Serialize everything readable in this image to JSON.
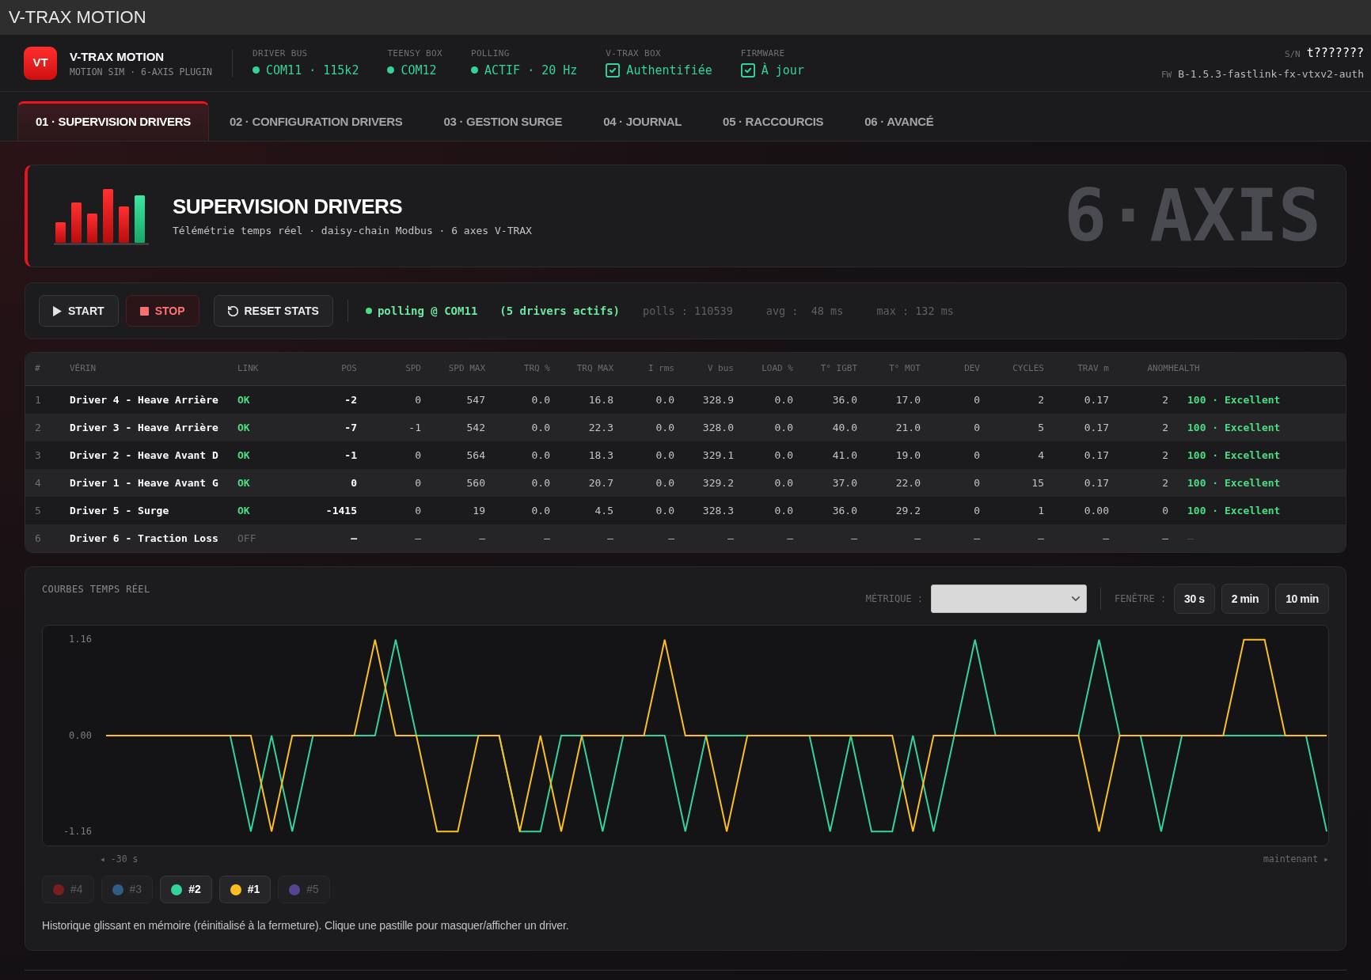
{
  "window": {
    "title": "V-TRAX MOTION"
  },
  "header": {
    "logo": "VT",
    "brand": "V-TRAX MOTION",
    "tagline": "MOTION SIM · 6-AXIS PLUGIN",
    "status": [
      {
        "kind": "dot",
        "label": "DRIVER BUS",
        "value": "COM11 · 115k2"
      },
      {
        "kind": "dot",
        "label": "TEENSY BOX",
        "value": "COM12"
      },
      {
        "kind": "dot",
        "label": "POLLING",
        "value": "ACTIF · 20 Hz"
      },
      {
        "kind": "check",
        "label": "V-TRAX BOX",
        "value": "Authentifiée",
        "checked": true
      },
      {
        "kind": "check",
        "label": "FIRMWARE",
        "value": "À jour",
        "checked": true
      }
    ],
    "serial": {
      "label": "S/N",
      "value": "t???????"
    },
    "firmware": {
      "label": "FW",
      "value": "B-1.5.3-fastlink-fx-vtxv2-auth"
    }
  },
  "tabs": [
    {
      "label": "01 · SUPERVISION DRIVERS",
      "selected": true
    },
    {
      "label": "02 · CONFIGURATION DRIVERS",
      "selected": false
    },
    {
      "label": "03 · GESTION SURGE",
      "selected": false
    },
    {
      "label": "04 · JOURNAL",
      "selected": false
    },
    {
      "label": "05 · RACCOURCIS",
      "selected": false
    },
    {
      "label": "06 · AVANCÉ",
      "selected": false
    }
  ],
  "hero": {
    "title": "SUPERVISION DRIVERS",
    "subtitle": "Télémétrie temps réel · daisy-chain Modbus · 6 axes V-TRAX",
    "axis_label": "6·AXIS"
  },
  "toolbar": {
    "buttons": [
      {
        "kind": "start",
        "label": "START"
      },
      {
        "kind": "stop",
        "label": "STOP"
      },
      {
        "kind": "reset",
        "label": "RESET STATS"
      }
    ],
    "polling": "polling @ COM11",
    "drivers": "(5 drivers actifs)",
    "stats": [
      "polls : 110539",
      "avg :  48 ms",
      "max : 132 ms"
    ]
  },
  "table": {
    "columns": [
      "#",
      "VÉRIN",
      "LINK",
      "POS",
      "SPD",
      "SPD MAX",
      "TRQ %",
      "TRQ MAX",
      "I rms",
      "V bus",
      "LOAD %",
      "T° IGBT",
      "T° MOT",
      "DEV",
      "CYCLES",
      "TRAV m",
      "ANOM",
      "HEALTH"
    ],
    "rows": [
      {
        "index": "1",
        "name": "Driver 4 - Heave Arrière",
        "link": "OK",
        "online": true,
        "values": [
          "-2",
          "0",
          "547",
          "0.0",
          "16.8",
          "0.0",
          "328.9",
          "0.0",
          "36.0",
          "17.0",
          "0",
          "2",
          "0.17",
          "2"
        ],
        "health": "100 · Excellent"
      },
      {
        "index": "2",
        "name": "Driver 3 - Heave Arrière",
        "link": "OK",
        "online": true,
        "values": [
          "-7",
          "-1",
          "542",
          "0.0",
          "22.3",
          "0.0",
          "328.0",
          "0.0",
          "40.0",
          "21.0",
          "0",
          "5",
          "0.17",
          "2"
        ],
        "health": "100 · Excellent"
      },
      {
        "index": "3",
        "name": "Driver 2 - Heave Avant D",
        "link": "OK",
        "online": true,
        "values": [
          "-1",
          "0",
          "564",
          "0.0",
          "18.3",
          "0.0",
          "329.1",
          "0.0",
          "41.0",
          "19.0",
          "0",
          "4",
          "0.17",
          "2"
        ],
        "health": "100 · Excellent"
      },
      {
        "index": "4",
        "name": "Driver 1 - Heave Avant G",
        "link": "OK",
        "online": true,
        "values": [
          "0",
          "0",
          "560",
          "0.0",
          "20.7",
          "0.0",
          "329.2",
          "0.0",
          "37.0",
          "22.0",
          "0",
          "15",
          "0.17",
          "2"
        ],
        "health": "100 · Excellent"
      },
      {
        "index": "5",
        "name": "Driver 5 - Surge",
        "link": "OK",
        "online": true,
        "values": [
          "-1415",
          "0",
          "19",
          "0.0",
          "4.5",
          "0.0",
          "328.3",
          "0.0",
          "36.0",
          "29.2",
          "0",
          "1",
          "0.00",
          "0"
        ],
        "health": "100 · Excellent"
      },
      {
        "index": "6",
        "name": "Driver 6 - Traction Loss",
        "link": "OFF",
        "online": false,
        "values": [
          "—",
          "—",
          "—",
          "—",
          "—",
          "—",
          "—",
          "—",
          "—",
          "—",
          "—",
          "—",
          "—",
          "—"
        ],
        "health": "—"
      }
    ]
  },
  "chart_panel": {
    "title": "COURBES TEMPS RÉEL",
    "metric_label": "MÉTRIQUE :",
    "window_label": "FENÊTRE :",
    "window_options": [
      "30 s",
      "2 min",
      "10 min"
    ],
    "chart_data": {
      "type": "line",
      "categories": [
        null,
        null,
        null,
        null,
        null,
        null,
        null,
        null,
        null,
        null,
        null,
        null,
        null,
        null,
        null,
        null,
        null,
        null,
        null,
        null,
        null,
        null,
        null,
        null,
        null,
        null,
        null,
        null,
        null,
        null,
        null,
        null,
        null,
        null,
        null,
        null,
        null,
        null,
        null,
        null,
        null,
        null,
        null,
        null,
        null,
        null,
        null,
        null,
        null,
        null,
        null,
        null,
        null,
        null,
        null,
        null,
        null,
        null,
        null,
        null
      ],
      "series": [
        {
          "name": "#2",
          "color": "#34d399",
          "values": [
            null,
            null,
            null,
            null,
            null,
            0,
            0,
            -1.16,
            0,
            -1.16,
            0,
            0,
            0,
            0,
            1.16,
            0,
            0,
            0,
            0,
            0,
            -1.16,
            -1.16,
            0,
            0,
            -1.16,
            0,
            0,
            0,
            -1.16,
            0,
            0,
            0,
            0,
            0,
            0,
            -1.16,
            0,
            -1.16,
            -1.16,
            0,
            -1.16,
            0,
            1.16,
            0,
            0,
            0,
            0,
            0,
            1.16,
            0,
            0,
            -1.16,
            0,
            0,
            0,
            0,
            0,
            0,
            0,
            -1.16
          ]
        },
        {
          "name": "#1",
          "color": "#fbbf24",
          "values": [
            0,
            0,
            0,
            0,
            0,
            0,
            0,
            0,
            -1.16,
            0,
            0,
            0,
            0,
            1.16,
            0,
            0,
            -1.16,
            -1.16,
            0,
            0,
            -1.16,
            0,
            -1.16,
            0,
            0,
            0,
            0,
            1.16,
            0,
            0,
            -1.16,
            0,
            0,
            0,
            0,
            0,
            0,
            0,
            0,
            -1.16,
            0,
            0,
            0,
            0,
            0,
            0,
            0,
            0,
            -1.16,
            0,
            0,
            0,
            0,
            0,
            0,
            1.16,
            1.16,
            0,
            0,
            0
          ]
        }
      ],
      "ylim": [
        -1.33,
        1.33
      ],
      "yticks": [
        {
          "value": 1.16,
          "label": "1.16"
        },
        {
          "value": 0,
          "label": "0.00"
        },
        {
          "value": -1.16,
          "label": "-1.16"
        }
      ],
      "legend": "bottom"
    },
    "x_axis_labels": [
      "◂ -30 s",
      "maintenant ▸"
    ],
    "legend_items": [
      {
        "label": "#4",
        "color": "#7a1f1f",
        "visible": false
      },
      {
        "label": "#3",
        "color": "#2f5d86",
        "visible": false
      },
      {
        "visible": true
      },
      {
        "visible": true
      },
      {
        "label": "#5",
        "color": "#574391",
        "visible": false
      }
    ],
    "note": "Historique glissant en mémoire (réinitialisé à la fermeture). Clique une pastille pour masquer/afficher un driver."
  }
}
